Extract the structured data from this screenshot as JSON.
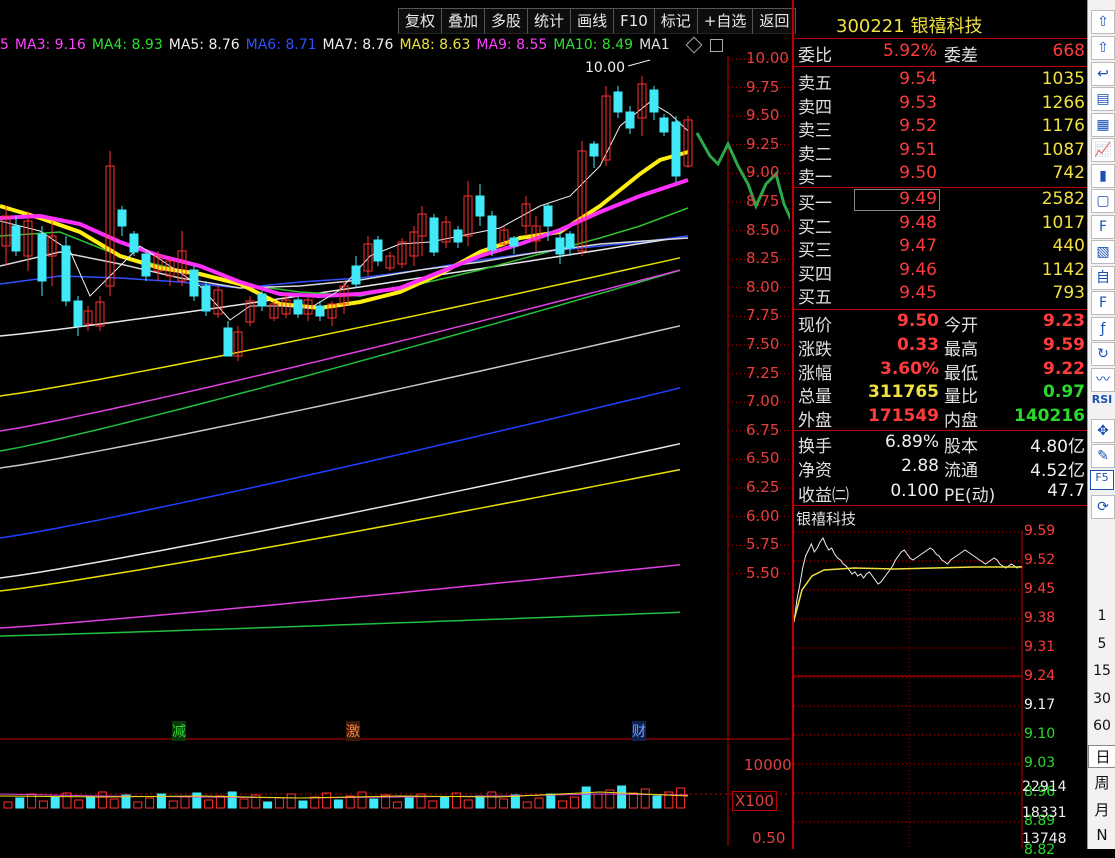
{
  "toolbar": [
    "复权",
    "叠加",
    "多股",
    "统计",
    "画线",
    "F10",
    "标记",
    "+自选",
    "返回"
  ],
  "ma_legend": [
    {
      "label": "5",
      "color": "#ff40ff"
    },
    {
      "label": "MA3: 9.16",
      "color": "#ff40ff"
    },
    {
      "label": "MA4: 8.93",
      "color": "#30e030"
    },
    {
      "label": "MA5: 8.76",
      "color": "#f0f0f0"
    },
    {
      "label": "MA6: 8.71",
      "color": "#3050ff"
    },
    {
      "label": "MA7: 8.76",
      "color": "#f0f0f0"
    },
    {
      "label": "MA8: 8.63",
      "color": "#f0e040"
    },
    {
      "label": "MA9: 8.55",
      "color": "#ff40ff"
    },
    {
      "label": "MA10: 8.49",
      "color": "#30e030"
    },
    {
      "label": "MA1",
      "color": "#e0e0e0"
    }
  ],
  "high_marker": "10.00",
  "price_axis": [
    "10.00",
    "9.75",
    "9.50",
    "9.25",
    "9.00",
    "8.75",
    "8.50",
    "8.25",
    "8.00",
    "7.75",
    "7.50",
    "7.25",
    "7.00",
    "6.75",
    "6.50",
    "6.25",
    "6.00",
    "5.75",
    "5.50"
  ],
  "event_markers": [
    {
      "label": "减",
      "color": "#30d030"
    },
    {
      "label": "激",
      "color": "#ff8040"
    },
    {
      "label": "财",
      "color": "#3a7bff"
    }
  ],
  "volume_axis": {
    "top": "10000",
    "unit": "X100",
    "bottom": "0.50"
  },
  "stock": {
    "code": "300221",
    "name": "银禧科技"
  },
  "weibi": {
    "k1": "委比",
    "v1": "5.92%",
    "k2": "委差",
    "v2": "668"
  },
  "asks": [
    {
      "k": "卖五",
      "price": "9.54",
      "vol": "1035"
    },
    {
      "k": "卖四",
      "price": "9.53",
      "vol": "1266"
    },
    {
      "k": "卖三",
      "price": "9.52",
      "vol": "1176"
    },
    {
      "k": "卖二",
      "price": "9.51",
      "vol": "1087"
    },
    {
      "k": "卖一",
      "price": "9.50",
      "vol": "742"
    }
  ],
  "bids": [
    {
      "k": "买一",
      "price": "9.49",
      "vol": "2582"
    },
    {
      "k": "买二",
      "price": "9.48",
      "vol": "1017"
    },
    {
      "k": "买三",
      "price": "9.47",
      "vol": "440"
    },
    {
      "k": "买四",
      "price": "9.46",
      "vol": "1142"
    },
    {
      "k": "买五",
      "price": "9.45",
      "vol": "793"
    }
  ],
  "stats": [
    {
      "k1": "现价",
      "v1": "9.50",
      "c1": "red",
      "k2": "今开",
      "v2": "9.23",
      "c2": "red"
    },
    {
      "k1": "涨跌",
      "v1": "0.33",
      "c1": "red",
      "k2": "最高",
      "v2": "9.59",
      "c2": "red"
    },
    {
      "k1": "涨幅",
      "v1": "3.60%",
      "c1": "red",
      "k2": "最低",
      "v2": "9.22",
      "c2": "red"
    },
    {
      "k1": "总量",
      "v1": "311765",
      "c1": "yellow",
      "k2": "量比",
      "v2": "0.97",
      "c2": "green"
    },
    {
      "k1": "外盘",
      "v1": "171549",
      "c1": "red",
      "k2": "内盘",
      "v2": "140216",
      "c2": "green"
    }
  ],
  "fundamentals": [
    {
      "k1": "换手",
      "v1": "6.89%",
      "k2": "股本",
      "v2": "4.80亿"
    },
    {
      "k1": "净资",
      "v1": "2.88",
      "k2": "流通",
      "v2": "4.52亿"
    },
    {
      "k1": "收益㈡",
      "v1": "0.100",
      "k2": "PE(动)",
      "v2": "47.7"
    }
  ],
  "intraday": {
    "title": "银禧科技",
    "price_axis": [
      {
        "v": "9.59",
        "c": "red"
      },
      {
        "v": "9.52",
        "c": "red"
      },
      {
        "v": "9.45",
        "c": "red"
      },
      {
        "v": "9.38",
        "c": "red"
      },
      {
        "v": "9.31",
        "c": "red"
      },
      {
        "v": "9.24",
        "c": "red"
      },
      {
        "v": "9.17",
        "c": "white"
      },
      {
        "v": "9.10",
        "c": "green"
      },
      {
        "v": "9.03",
        "c": "green"
      },
      {
        "v": "8.96",
        "c": "green"
      },
      {
        "v": "8.89",
        "c": "green"
      },
      {
        "v": "8.82",
        "c": "green"
      }
    ],
    "vol_axis": [
      "22914",
      "18331",
      "13748"
    ]
  },
  "right_toolbar": {
    "icons": [
      "up-arrow-icon",
      "arrow-up-icon",
      "back-arrow-icon",
      "list-icon",
      "grid-icon",
      "line-chart-icon",
      "candle-icon",
      "window-icon",
      "f10-icon",
      "doc-icon",
      "self-icon",
      "f12-icon",
      "function-icon",
      "refresh-icon",
      "wave-icon",
      "rsi-icon",
      "move-icon",
      "pen-icon",
      "f5-icon",
      "sync-icon"
    ],
    "labels": [
      "RSI",
      "F5"
    ],
    "periods": [
      "1",
      "5",
      "15",
      "30",
      "60"
    ],
    "views": [
      "日",
      "周",
      "月",
      "N"
    ]
  }
}
